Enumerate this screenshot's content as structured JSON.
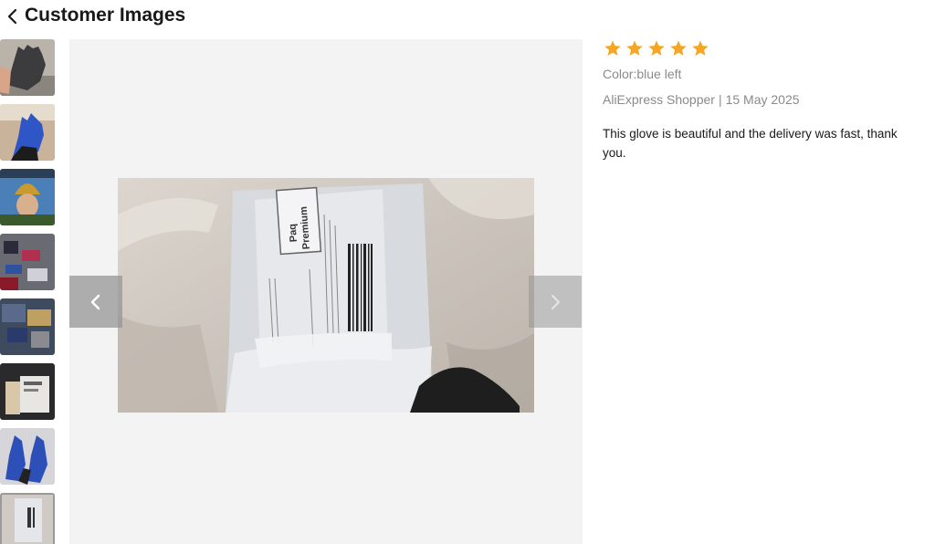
{
  "header": {
    "title": "Customer Images",
    "back_icon": "chevron-left-icon"
  },
  "thumbnails": [
    {
      "label": "gray glove on hand"
    },
    {
      "label": "blue glove on hand"
    },
    {
      "label": "person with gold helmet"
    },
    {
      "label": "colorful items pile"
    },
    {
      "label": "items in box"
    },
    {
      "label": "package photo"
    },
    {
      "label": "blue gloves pair"
    },
    {
      "label": "package on bed",
      "active": true
    }
  ],
  "viewer": {
    "prev_icon": "chevron-left-icon",
    "next_icon": "chevron-right-icon",
    "label_line1": "Paq",
    "label_line2": "Premium"
  },
  "review": {
    "rating": 5,
    "color": "Color:blue left",
    "author": "AliExpress Shopper",
    "separator": "|",
    "date": "15 May 2025",
    "text": "This glove is beautiful and the delivery was fast, thank you.",
    "star_color": "#f5a623"
  }
}
